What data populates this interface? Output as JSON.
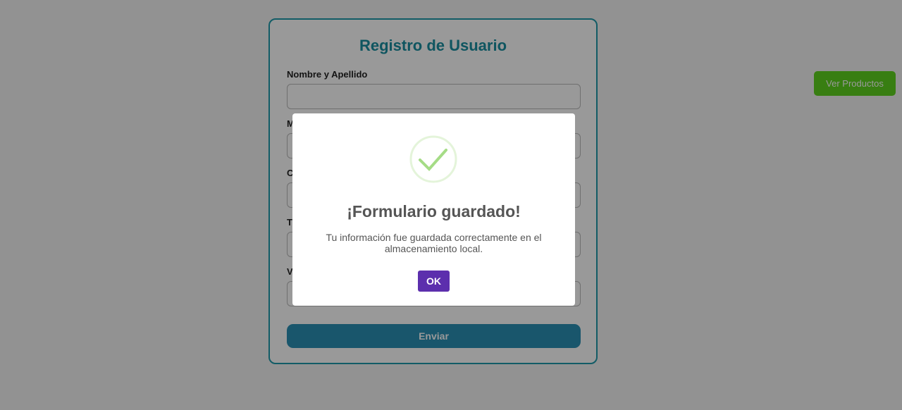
{
  "form": {
    "title": "Registro de Usuario",
    "fields": [
      {
        "label": "Nombre y Apellido",
        "value": ""
      },
      {
        "label": "M",
        "value": ""
      },
      {
        "label": "C",
        "value": ""
      },
      {
        "label": "T",
        "value": ""
      },
      {
        "label": "V",
        "value": "",
        "type": "select"
      }
    ],
    "submit_label": "Enviar"
  },
  "header": {
    "products_button_label": "Ver Productos"
  },
  "modal": {
    "icon": "check-icon",
    "title": "¡Formulario guardado!",
    "text": "Tu información fue guardada correctamente en el almacenamiento local.",
    "ok_label": "OK"
  },
  "colors": {
    "accent": "#1a8ea0",
    "submit": "#2a8fb5",
    "products_button": "#5ed21f",
    "ok_button": "#5c2fad",
    "success": "#a5dc86"
  }
}
